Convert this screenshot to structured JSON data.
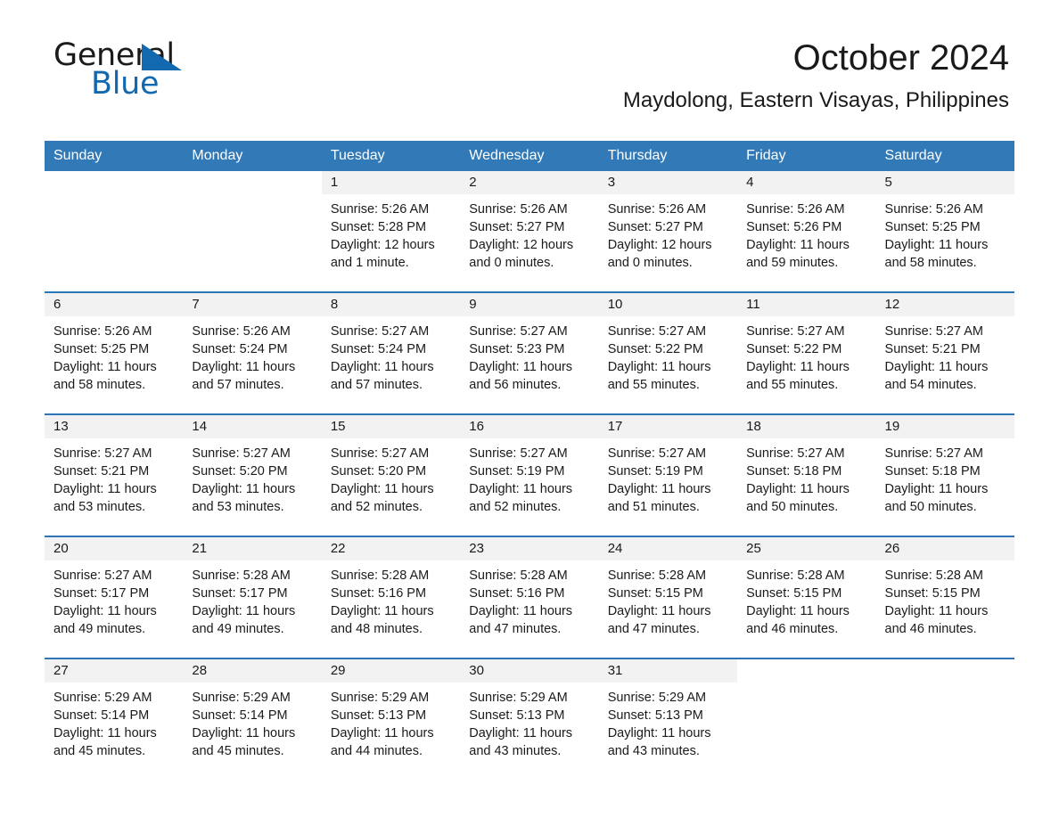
{
  "brand": {
    "word1": "General",
    "word2": "Blue",
    "triangle_color": "#1269b0"
  },
  "header": {
    "month_title": "October 2024",
    "location": "Maydolong, Eastern Visayas, Philippines",
    "accent_color": "#3279b7"
  },
  "weekday_headers": [
    "Sunday",
    "Monday",
    "Tuesday",
    "Wednesday",
    "Thursday",
    "Friday",
    "Saturday"
  ],
  "labels": {
    "sunrise_prefix": "Sunrise:",
    "sunset_prefix": "Sunset:",
    "daylight_prefix": "Daylight:"
  },
  "weeks": [
    [
      {
        "day": "",
        "lines": []
      },
      {
        "day": "",
        "lines": []
      },
      {
        "day": "1",
        "lines": [
          "Sunrise: 5:26 AM",
          "Sunset: 5:28 PM",
          "Daylight: 12 hours",
          "and 1 minute."
        ]
      },
      {
        "day": "2",
        "lines": [
          "Sunrise: 5:26 AM",
          "Sunset: 5:27 PM",
          "Daylight: 12 hours",
          "and 0 minutes."
        ]
      },
      {
        "day": "3",
        "lines": [
          "Sunrise: 5:26 AM",
          "Sunset: 5:27 PM",
          "Daylight: 12 hours",
          "and 0 minutes."
        ]
      },
      {
        "day": "4",
        "lines": [
          "Sunrise: 5:26 AM",
          "Sunset: 5:26 PM",
          "Daylight: 11 hours",
          "and 59 minutes."
        ]
      },
      {
        "day": "5",
        "lines": [
          "Sunrise: 5:26 AM",
          "Sunset: 5:25 PM",
          "Daylight: 11 hours",
          "and 58 minutes."
        ]
      }
    ],
    [
      {
        "day": "6",
        "lines": [
          "Sunrise: 5:26 AM",
          "Sunset: 5:25 PM",
          "Daylight: 11 hours",
          "and 58 minutes."
        ]
      },
      {
        "day": "7",
        "lines": [
          "Sunrise: 5:26 AM",
          "Sunset: 5:24 PM",
          "Daylight: 11 hours",
          "and 57 minutes."
        ]
      },
      {
        "day": "8",
        "lines": [
          "Sunrise: 5:27 AM",
          "Sunset: 5:24 PM",
          "Daylight: 11 hours",
          "and 57 minutes."
        ]
      },
      {
        "day": "9",
        "lines": [
          "Sunrise: 5:27 AM",
          "Sunset: 5:23 PM",
          "Daylight: 11 hours",
          "and 56 minutes."
        ]
      },
      {
        "day": "10",
        "lines": [
          "Sunrise: 5:27 AM",
          "Sunset: 5:22 PM",
          "Daylight: 11 hours",
          "and 55 minutes."
        ]
      },
      {
        "day": "11",
        "lines": [
          "Sunrise: 5:27 AM",
          "Sunset: 5:22 PM",
          "Daylight: 11 hours",
          "and 55 minutes."
        ]
      },
      {
        "day": "12",
        "lines": [
          "Sunrise: 5:27 AM",
          "Sunset: 5:21 PM",
          "Daylight: 11 hours",
          "and 54 minutes."
        ]
      }
    ],
    [
      {
        "day": "13",
        "lines": [
          "Sunrise: 5:27 AM",
          "Sunset: 5:21 PM",
          "Daylight: 11 hours",
          "and 53 minutes."
        ]
      },
      {
        "day": "14",
        "lines": [
          "Sunrise: 5:27 AM",
          "Sunset: 5:20 PM",
          "Daylight: 11 hours",
          "and 53 minutes."
        ]
      },
      {
        "day": "15",
        "lines": [
          "Sunrise: 5:27 AM",
          "Sunset: 5:20 PM",
          "Daylight: 11 hours",
          "and 52 minutes."
        ]
      },
      {
        "day": "16",
        "lines": [
          "Sunrise: 5:27 AM",
          "Sunset: 5:19 PM",
          "Daylight: 11 hours",
          "and 52 minutes."
        ]
      },
      {
        "day": "17",
        "lines": [
          "Sunrise: 5:27 AM",
          "Sunset: 5:19 PM",
          "Daylight: 11 hours",
          "and 51 minutes."
        ]
      },
      {
        "day": "18",
        "lines": [
          "Sunrise: 5:27 AM",
          "Sunset: 5:18 PM",
          "Daylight: 11 hours",
          "and 50 minutes."
        ]
      },
      {
        "day": "19",
        "lines": [
          "Sunrise: 5:27 AM",
          "Sunset: 5:18 PM",
          "Daylight: 11 hours",
          "and 50 minutes."
        ]
      }
    ],
    [
      {
        "day": "20",
        "lines": [
          "Sunrise: 5:27 AM",
          "Sunset: 5:17 PM",
          "Daylight: 11 hours",
          "and 49 minutes."
        ]
      },
      {
        "day": "21",
        "lines": [
          "Sunrise: 5:28 AM",
          "Sunset: 5:17 PM",
          "Daylight: 11 hours",
          "and 49 minutes."
        ]
      },
      {
        "day": "22",
        "lines": [
          "Sunrise: 5:28 AM",
          "Sunset: 5:16 PM",
          "Daylight: 11 hours",
          "and 48 minutes."
        ]
      },
      {
        "day": "23",
        "lines": [
          "Sunrise: 5:28 AM",
          "Sunset: 5:16 PM",
          "Daylight: 11 hours",
          "and 47 minutes."
        ]
      },
      {
        "day": "24",
        "lines": [
          "Sunrise: 5:28 AM",
          "Sunset: 5:15 PM",
          "Daylight: 11 hours",
          "and 47 minutes."
        ]
      },
      {
        "day": "25",
        "lines": [
          "Sunrise: 5:28 AM",
          "Sunset: 5:15 PM",
          "Daylight: 11 hours",
          "and 46 minutes."
        ]
      },
      {
        "day": "26",
        "lines": [
          "Sunrise: 5:28 AM",
          "Sunset: 5:15 PM",
          "Daylight: 11 hours",
          "and 46 minutes."
        ]
      }
    ],
    [
      {
        "day": "27",
        "lines": [
          "Sunrise: 5:29 AM",
          "Sunset: 5:14 PM",
          "Daylight: 11 hours",
          "and 45 minutes."
        ]
      },
      {
        "day": "28",
        "lines": [
          "Sunrise: 5:29 AM",
          "Sunset: 5:14 PM",
          "Daylight: 11 hours",
          "and 45 minutes."
        ]
      },
      {
        "day": "29",
        "lines": [
          "Sunrise: 5:29 AM",
          "Sunset: 5:13 PM",
          "Daylight: 11 hours",
          "and 44 minutes."
        ]
      },
      {
        "day": "30",
        "lines": [
          "Sunrise: 5:29 AM",
          "Sunset: 5:13 PM",
          "Daylight: 11 hours",
          "and 43 minutes."
        ]
      },
      {
        "day": "31",
        "lines": [
          "Sunrise: 5:29 AM",
          "Sunset: 5:13 PM",
          "Daylight: 11 hours",
          "and 43 minutes."
        ]
      },
      {
        "day": "",
        "lines": []
      },
      {
        "day": "",
        "lines": []
      }
    ]
  ]
}
